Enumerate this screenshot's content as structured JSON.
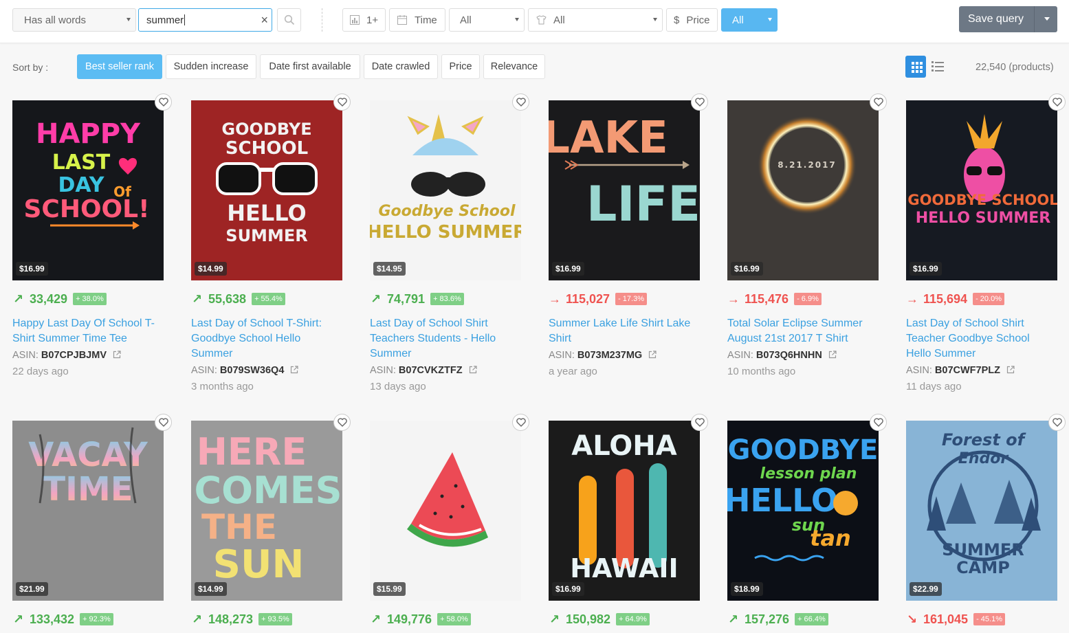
{
  "toolbar": {
    "match_mode": "Has all words",
    "search_value": "summer",
    "clear_glyph": "×",
    "bsr_filter": "1+",
    "time_filter": "Time",
    "category_filter": "All",
    "type_filter": "All",
    "price_filter_symbol": "$",
    "price_filter": "Price",
    "market_filter": "All",
    "save_query": "Save query"
  },
  "sort": {
    "label": "Sort by :",
    "options": [
      "Best seller rank",
      "Sudden increase",
      "Date first available",
      "Date crawled",
      "Price",
      "Relevance"
    ],
    "active": "Best seller rank"
  },
  "results": {
    "count": "22,540 (products)"
  },
  "products": [
    {
      "price": "$16.99",
      "trend": "up",
      "rank": "33,429",
      "change": "+ 38.0%",
      "title": "Happy Last Day Of School T-Shirt Summer Time Tee",
      "asin_label": "ASIN:",
      "asin": "B07CPJBJMV",
      "age": "22 days ago",
      "art_text": [
        "HAPPY",
        "LAST",
        "DAY",
        "Of",
        "SCHOOL!"
      ],
      "colors": {
        "bg": "#15171b"
      }
    },
    {
      "price": "$14.99",
      "trend": "up",
      "rank": "55,638",
      "change": "+ 55.4%",
      "title": "Last Day of School T-Shirt: Goodbye School Hello Summer",
      "asin_label": "ASIN:",
      "asin": "B079SW36Q4",
      "age": "3 months ago",
      "art_text": [
        "GOODBYE",
        "SCHOOL",
        "HELLO",
        "SUMMER"
      ],
      "colors": {
        "bg": "#9e2424"
      }
    },
    {
      "price": "$14.95",
      "trend": "up",
      "rank": "74,791",
      "change": "+ 83.6%",
      "title": "Last Day of School Shirt Teachers Students - Hello Summer",
      "asin_label": "ASIN:",
      "asin": "B07CVKZTFZ",
      "age": "13 days ago",
      "art_text": [
        "Goodbye School",
        "HELLO SUMMER"
      ],
      "colors": {
        "bg": "#f4f4f4"
      }
    },
    {
      "price": "$16.99",
      "trend": "down",
      "rank": "115,027",
      "change": "- 17.3%",
      "title": "Summer Lake Life Shirt Lake Shirt",
      "asin_label": "ASIN:",
      "asin": "B073M237MG",
      "age": "a year ago",
      "art_text": [
        "LAKE",
        "LIFE"
      ],
      "colors": {
        "bg": "#1a1a1c"
      }
    },
    {
      "price": "$16.99",
      "trend": "down",
      "rank": "115,476",
      "change": "- 6.9%",
      "title": "Total Solar Eclipse Summer August 21st 2017 T Shirt",
      "asin_label": "ASIN:",
      "asin": "B073Q6HNHN",
      "age": "10 months ago",
      "art_text": [
        "8.21.2017"
      ],
      "colors": {
        "bg": "#3e3a37"
      }
    },
    {
      "price": "$16.99",
      "trend": "down",
      "rank": "115,694",
      "change": "- 20.0%",
      "title": "Last Day of School Shirt Teacher Goodbye School Hello Summer",
      "asin_label": "ASIN:",
      "asin": "B07CWF7PLZ",
      "age": "11 days ago",
      "art_text": [
        "GOODBYE SCHOOL",
        "HELLO SUMMER"
      ],
      "colors": {
        "bg": "#161a22"
      }
    },
    {
      "price": "$21.99",
      "trend": "up",
      "rank": "133,432",
      "change": "+ 92.3%",
      "art_text": [
        "VACAY",
        "TIME"
      ],
      "colors": {
        "bg": "#8d8d8d"
      }
    },
    {
      "price": "$14.99",
      "trend": "up",
      "rank": "148,273",
      "change": "+ 93.5%",
      "art_text": [
        "HERE",
        "COMES",
        "THE",
        "SUN"
      ],
      "colors": {
        "bg": "#9a9a9a"
      }
    },
    {
      "price": "$15.99",
      "trend": "up",
      "rank": "149,776",
      "change": "+ 58.0%",
      "art_text": [],
      "colors": {
        "bg": "#f4f4f4"
      }
    },
    {
      "price": "$16.99",
      "trend": "up",
      "rank": "150,982",
      "change": "+ 64.9%",
      "art_text": [
        "ALOHA",
        "HAWAII"
      ],
      "colors": {
        "bg": "#1b1b1b"
      }
    },
    {
      "price": "$18.99",
      "trend": "up",
      "rank": "157,276",
      "change": "+ 66.4%",
      "art_text": [
        "GOODBYE",
        "lesson plan",
        "HELLO",
        "sun",
        "tan"
      ],
      "colors": {
        "bg": "#0c0f16"
      }
    },
    {
      "price": "$22.99",
      "trend": "down",
      "rank": "161,045",
      "change": "- 45.1%",
      "art_text": [
        "Forest of",
        "Endor",
        "SUMMER",
        "CAMP"
      ],
      "colors": {
        "bg": "#88b4d6"
      }
    }
  ]
}
